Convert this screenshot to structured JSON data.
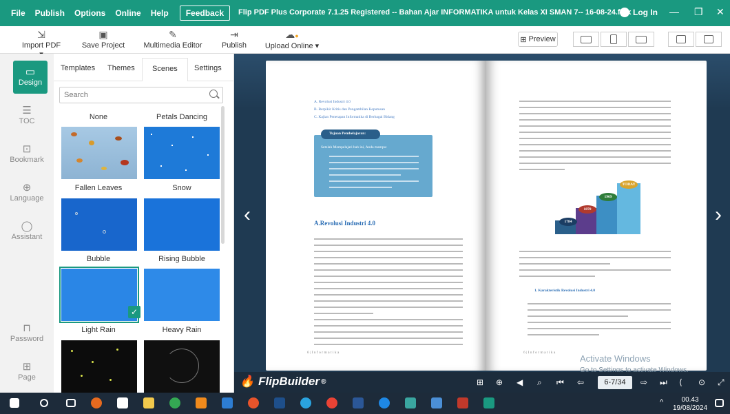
{
  "menu": {
    "file": "File",
    "publish": "Publish",
    "options": "Options",
    "online": "Online",
    "help": "Help",
    "feedback": "Feedback"
  },
  "window": {
    "title": "Flip PDF Plus Corporate 7.1.25 Registered -- Bahan Ajar INFORMATIKA untuk Kelas XI SMAN 7-- 16-08-24.flbx",
    "login": "Log In"
  },
  "toolbar": {
    "import": "Import PDF ▾",
    "save": "Save Project",
    "multimedia": "Multimedia Editor",
    "publish": "Publish",
    "upload": "Upload Online ▾",
    "preview": "Preview"
  },
  "rail": {
    "design": "Design",
    "toc": "TOC",
    "bookmark": "Bookmark",
    "language": "Language",
    "assistant": "Assistant",
    "password": "Password",
    "page": "Page"
  },
  "tabs": {
    "templates": "Templates",
    "themes": "Themes",
    "scenes": "Scenes",
    "settings": "Settings"
  },
  "search": {
    "placeholder": "Search"
  },
  "scenes": {
    "none": "None",
    "petals": "Petals Dancing",
    "fallen": "Fallen Leaves",
    "snow": "Snow",
    "bubble": "Bubble",
    "rising": "Rising Bubble",
    "light": "Light Rain",
    "heavy": "Heavy Rain"
  },
  "book": {
    "toc1": "A.  Revolusi Industri 4.0",
    "toc2": "B.  Berpikir Kritis dan Pengambilan Keputusan",
    "toc3": "C.  Kajian Penerapan Informatika di Berbagai Bidang",
    "goal_title": "Tujuan Pembelajaran:",
    "goal_intro": "Setelah Mempelajari bab ini, Anda mampu:",
    "heading": "A.Revolusi Industri 4.0",
    "footer_left": "6 | I n f o r m a t i k a",
    "footer_right": "6 | I n f o r m a t i k a",
    "right_heading": "1.  Karakteristik Revolusi Industri 4.0",
    "chart_today": "TODAY",
    "chart_1969": "1969",
    "chart_1870": "1870",
    "chart_1784": "1784"
  },
  "viewer": {
    "brand": "FlipBuilder",
    "page_no": "6-7/34"
  },
  "windows": {
    "activate1": "Activate Windows",
    "activate2": "Go to Settings to activate Windows.",
    "time": "00.43",
    "date": "19/08/2024"
  },
  "colors": {
    "accent": "#1a9980",
    "stage": "#1f3a52",
    "taskbar": "#1d2b3a"
  }
}
